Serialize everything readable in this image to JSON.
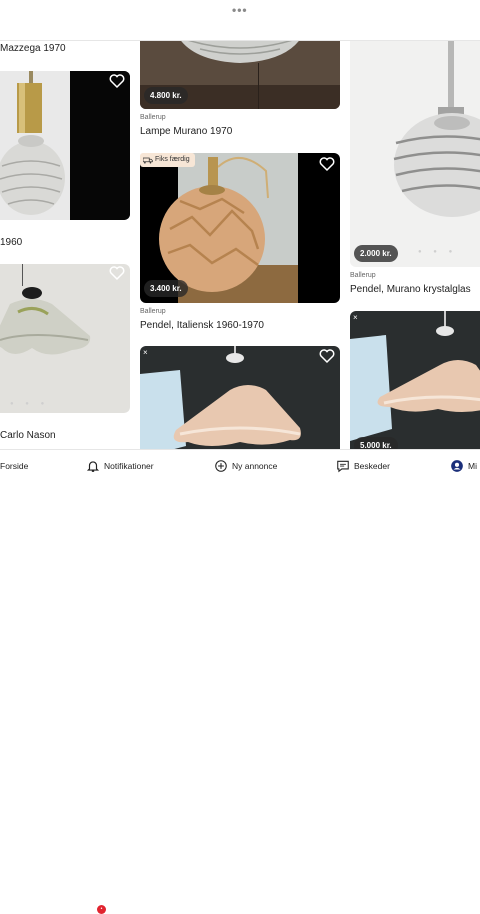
{
  "app": {
    "menu_dots": "•••"
  },
  "feed": {
    "col1": [
      {
        "title": "Mazzega 1970"
      },
      {
        "title": "1960",
        "heart": "heart-outline-icon"
      },
      {
        "title": "Carlo Nason",
        "heart": "heart-outline-icon"
      }
    ],
    "col2": [
      {
        "price": "4.800 kr.",
        "location": "Ballerup",
        "title": "Lampe Murano 1970"
      },
      {
        "badge": "Fiks færdig",
        "badge_icon": "truck-icon",
        "price": "3.400 kr.",
        "location": "Ballerup",
        "title": "Pendel, Italiensk 1960-1970",
        "heart": "heart-outline-icon"
      },
      {
        "close": "×",
        "heart": "heart-outline-icon"
      }
    ],
    "col3": [
      {
        "price": "2.000 kr.",
        "location": "Ballerup",
        "title": "Pendel, Murano krystalglas"
      },
      {
        "close": "×",
        "price": "5.000 kr."
      }
    ]
  },
  "bottom_nav": [
    {
      "label": "Forside",
      "icon": "home-icon"
    },
    {
      "label": "Notifikationer",
      "icon": "bell-icon",
      "badge": "•"
    },
    {
      "label": "Ny annonce",
      "icon": "plus-circle-icon"
    },
    {
      "label": "Beskeder",
      "icon": "chat-icon"
    },
    {
      "label": "Mi",
      "icon": "profile-icon"
    }
  ],
  "colors": {
    "price_pill": "#282828",
    "badge_bg": "#f7e6d6",
    "notif_dot": "#e1242f",
    "active_profile": "#1b2f7a"
  }
}
